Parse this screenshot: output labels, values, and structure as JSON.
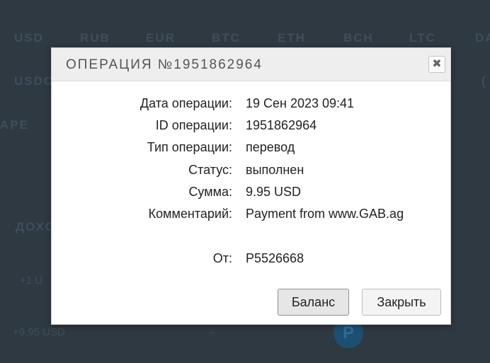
{
  "background": {
    "currencies": [
      "USD",
      "RUB",
      "EUR",
      "BTC",
      "ETH",
      "BCH",
      "LTC",
      "DA"
    ],
    "row2_label": "USDC",
    "row2_right": "(",
    "row3_label": "APE",
    "section_label": "ДОХО",
    "item1": "+1 U",
    "item2": "+9.95 USD",
    "item2_mid": "–",
    "avatar_letter": "P"
  },
  "modal": {
    "title": "ОПЕРАЦИЯ №1951862964",
    "close_glyph": "✖",
    "rows": [
      {
        "label": "Дата операции:",
        "value": "19 Сен 2023 09:41"
      },
      {
        "label": "ID операции:",
        "value": "1951862964"
      },
      {
        "label": "Тип операции:",
        "value": "перевод"
      },
      {
        "label": "Статус:",
        "value": "выполнен"
      },
      {
        "label": "Сумма:",
        "value": "9.95 USD"
      },
      {
        "label": "Комментарий:",
        "value": "Payment from www.GAB.ag"
      },
      {
        "label": "От:",
        "value": "P5526668"
      }
    ],
    "balance_button": "Баланс",
    "close_button": "Закрыть"
  }
}
